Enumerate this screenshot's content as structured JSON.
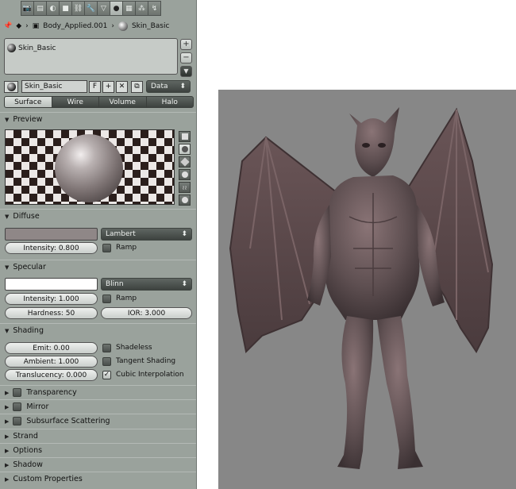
{
  "breadcrumb": {
    "object": "Body_Applied.001",
    "material": "Skin_Basic"
  },
  "material_slots": [
    {
      "label": "Skin_Basic"
    }
  ],
  "datablock": {
    "name": "Skin_Basic",
    "fake_user": "F",
    "link_mode": "Data"
  },
  "tabs": [
    "Surface",
    "Wire",
    "Volume",
    "Halo"
  ],
  "sections": {
    "preview": "Preview",
    "diffuse": "Diffuse",
    "specular": "Specular",
    "shading": "Shading",
    "transparency": "Transparency",
    "mirror": "Mirror",
    "subsurface": "Subsurface Scattering",
    "strand": "Strand",
    "options": "Options",
    "shadow": "Shadow",
    "custom_properties": "Custom Properties"
  },
  "diffuse": {
    "shader": "Lambert",
    "intensity": "Intensity: 0.800",
    "ramp": "Ramp",
    "color": "#8f8787"
  },
  "specular": {
    "shader": "Blinn",
    "intensity": "Intensity: 1.000",
    "ramp": "Ramp",
    "hardness": "Hardness: 50",
    "ior": "IOR: 3.000",
    "color": "#ffffff"
  },
  "shading": {
    "emit": "Emit: 0.00",
    "ambient": "Ambient: 1.000",
    "translucency": "Translucency: 0.000",
    "shadeless": "Shadeless",
    "tangent": "Tangent Shading",
    "cubic": "Cubic Interpolation"
  },
  "icons": {
    "tabbar": [
      "render-icon",
      "scene-icon",
      "world-icon",
      "object-icon",
      "constraints-icon",
      "modifiers-icon",
      "data-icon",
      "material-icon",
      "texture-icon",
      "particles-icon",
      "physics-icon"
    ],
    "preview_types": [
      "flat-icon",
      "sphere-icon",
      "cube-icon",
      "monkey-icon",
      "hair-icon",
      "sky-icon"
    ]
  },
  "colors": {
    "panel_bg": "#9aa29c",
    "render_bg": "#878787",
    "creature": "#5e4f51"
  }
}
